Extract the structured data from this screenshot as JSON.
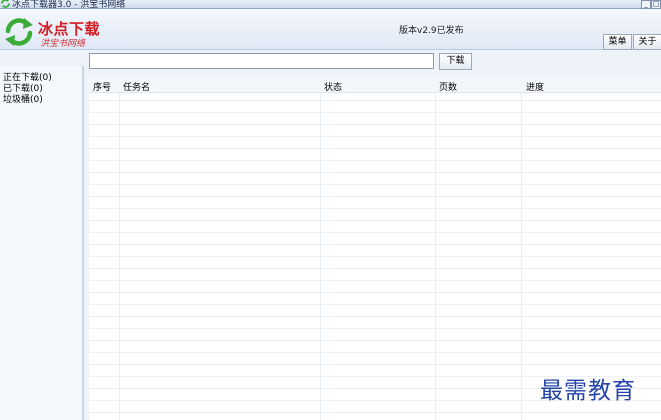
{
  "window": {
    "title": "冰点下载器3.0 - 洪宝书网络",
    "minimize_label": "_",
    "maximize_label": "□"
  },
  "header": {
    "logo_title": "冰点下载",
    "logo_subtitle": "洪宝书网络",
    "version_text": "版本v2.9已发布",
    "menu_label": "菜单",
    "about_label": "关于"
  },
  "search": {
    "value": "",
    "placeholder": "",
    "download_label": "下载"
  },
  "sidebar": {
    "items": [
      {
        "label": "正在下载(0)"
      },
      {
        "label": "已下载(0)"
      },
      {
        "label": "垃圾桶(0)"
      }
    ]
  },
  "table": {
    "columns": [
      "序号",
      "任务名",
      "状态",
      "页数",
      "进度"
    ],
    "rows": []
  },
  "watermark": "最需教育",
  "colors": {
    "logo_red": "#d21d24",
    "accent_green": "#3bab3a",
    "watermark_blue": "#2444a8"
  },
  "icons": {
    "app": "recycle-arrows-icon"
  }
}
